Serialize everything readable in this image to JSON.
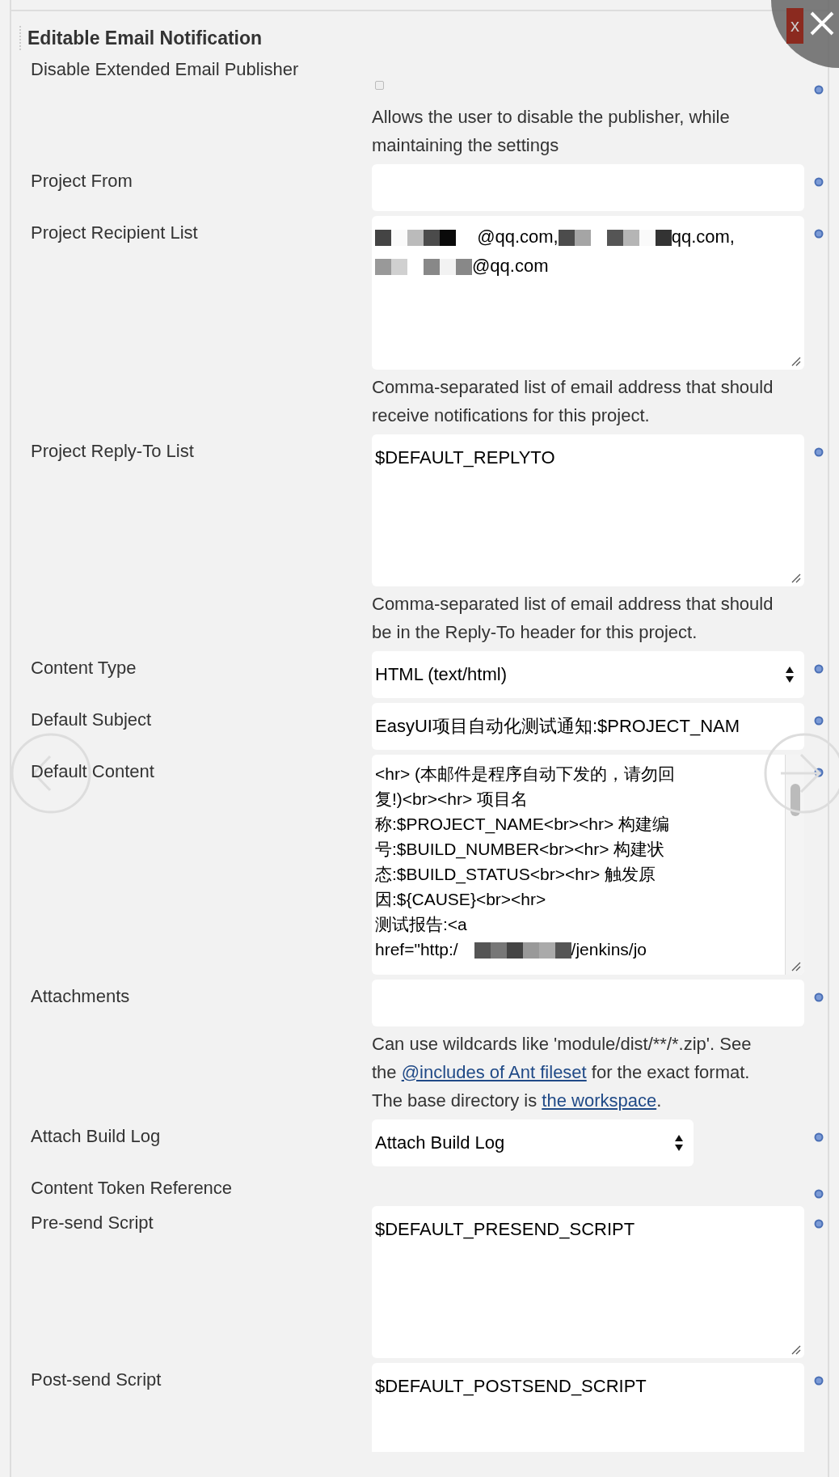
{
  "section": {
    "title": "Editable Email Notification"
  },
  "overlay": {
    "close_badge": "x"
  },
  "rows": [
    {
      "kind": "checkbox",
      "label": "Disable Extended Email Publisher",
      "checked": false,
      "description": "Allows the user to disable the publisher, while maintaining the settings"
    },
    {
      "kind": "input",
      "label": "Project From"
    },
    {
      "kind": "recipients",
      "label": "Project Recipient List",
      "segments": [
        "@qq.com,",
        "qq.com,",
        "@qq.com"
      ],
      "description": "Comma-separated list of email address that should receive notifications for this project."
    },
    {
      "kind": "textarea",
      "label": "Project Reply-To List",
      "value": "$DEFAULT_REPLYTO",
      "description": "Comma-separated list of email address that should be in the Reply-To header for this project."
    },
    {
      "kind": "select",
      "label": "Content Type",
      "value": "HTML (text/html)"
    },
    {
      "kind": "input",
      "label": "Default Subject",
      "value": "EasyUI项目自动化测试通知:$PROJECT_NAM"
    },
    {
      "kind": "content",
      "label": "Default Content",
      "lines": [
        "<hr> (本邮件是程序自动下发的，请勿回",
        "复!)<br><hr> 项目名",
        "称:$PROJECT_NAME<br><hr> 构建编",
        "号:$BUILD_NUMBER<br><hr> 构建状",
        "态:$BUILD_STATUS<br><hr> 触发原",
        "因:${CAUSE}<br><hr>",
        "测试报告:<a"
      ],
      "last_line": [
        "href=\"http:/",
        "/jenkins/jo"
      ]
    },
    {
      "kind": "input",
      "label": "Attachments",
      "description_parts": [
        {
          "text": "Can use wildcards like 'module/dist/**/*.zip'. See the "
        },
        {
          "text": "@includes of Ant fileset",
          "link": true
        },
        {
          "text": " for the exact format. The base directory is "
        },
        {
          "text": "the workspace",
          "link": true
        },
        {
          "text": "."
        }
      ]
    },
    {
      "kind": "small-select",
      "label": "Attach Build Log",
      "value": "Attach Build Log"
    },
    {
      "kind": "none",
      "label": "Content Token Reference"
    },
    {
      "kind": "textarea",
      "label": "Pre-send Script",
      "value": "$DEFAULT_PRESEND_SCRIPT"
    },
    {
      "kind": "textarea-cut",
      "label": "Post-send Script",
      "value": "$DEFAULT_POSTSEND_SCRIPT"
    }
  ]
}
